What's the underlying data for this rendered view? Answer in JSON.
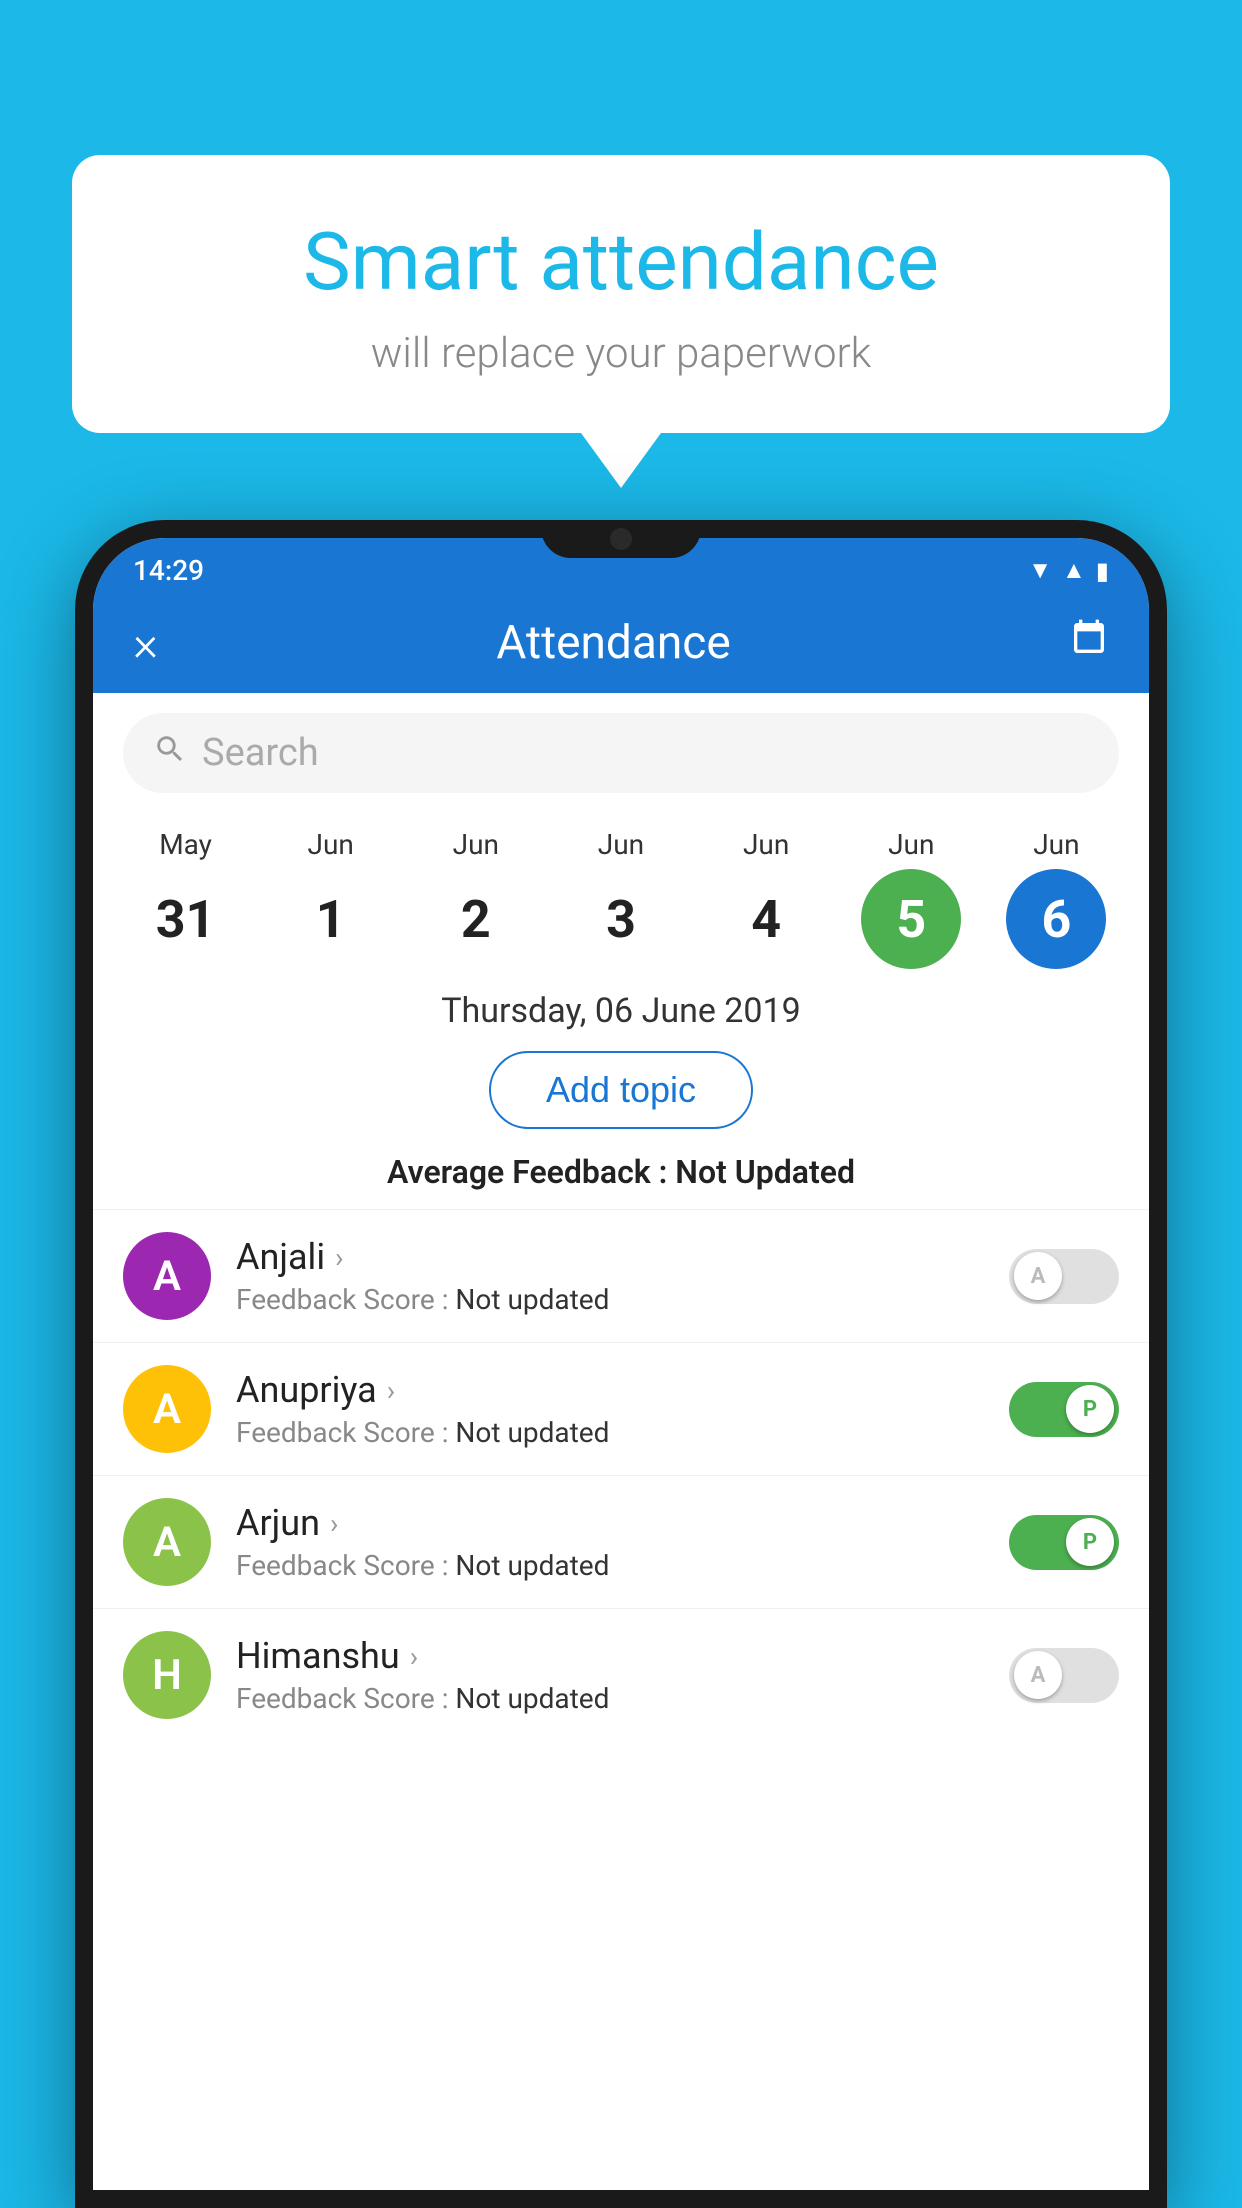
{
  "background_color": "#1BB8E8",
  "speech_bubble": {
    "title": "Smart attendance",
    "subtitle": "will replace your paperwork"
  },
  "status_bar": {
    "time": "14:29",
    "icons": [
      "wifi",
      "signal",
      "battery"
    ]
  },
  "header": {
    "title": "Attendance",
    "close_label": "×",
    "calendar_icon": "📅"
  },
  "search": {
    "placeholder": "Search"
  },
  "dates": [
    {
      "month": "May",
      "day": "31",
      "style": "normal"
    },
    {
      "month": "Jun",
      "day": "1",
      "style": "normal"
    },
    {
      "month": "Jun",
      "day": "2",
      "style": "normal"
    },
    {
      "month": "Jun",
      "day": "3",
      "style": "normal"
    },
    {
      "month": "Jun",
      "day": "4",
      "style": "normal"
    },
    {
      "month": "Jun",
      "day": "5",
      "style": "green"
    },
    {
      "month": "Jun",
      "day": "6",
      "style": "blue"
    }
  ],
  "selected_date": "Thursday, 06 June 2019",
  "add_topic_label": "Add topic",
  "avg_feedback_label": "Average Feedback :",
  "avg_feedback_value": "Not Updated",
  "students": [
    {
      "name": "Anjali",
      "avatar_letter": "A",
      "avatar_color": "#9C27B0",
      "feedback_label": "Feedback Score :",
      "feedback_value": "Not updated",
      "toggle_state": "off",
      "toggle_label": "A"
    },
    {
      "name": "Anupriya",
      "avatar_letter": "A",
      "avatar_color": "#FFC107",
      "feedback_label": "Feedback Score :",
      "feedback_value": "Not updated",
      "toggle_state": "on",
      "toggle_label": "P"
    },
    {
      "name": "Arjun",
      "avatar_letter": "A",
      "avatar_color": "#8BC34A",
      "feedback_label": "Feedback Score :",
      "feedback_value": "Not updated",
      "toggle_state": "on",
      "toggle_label": "P"
    },
    {
      "name": "Himanshu",
      "avatar_letter": "H",
      "avatar_color": "#8BC34A",
      "feedback_label": "Feedback Score :",
      "feedback_value": "Not updated",
      "toggle_state": "off",
      "toggle_label": "A"
    }
  ]
}
